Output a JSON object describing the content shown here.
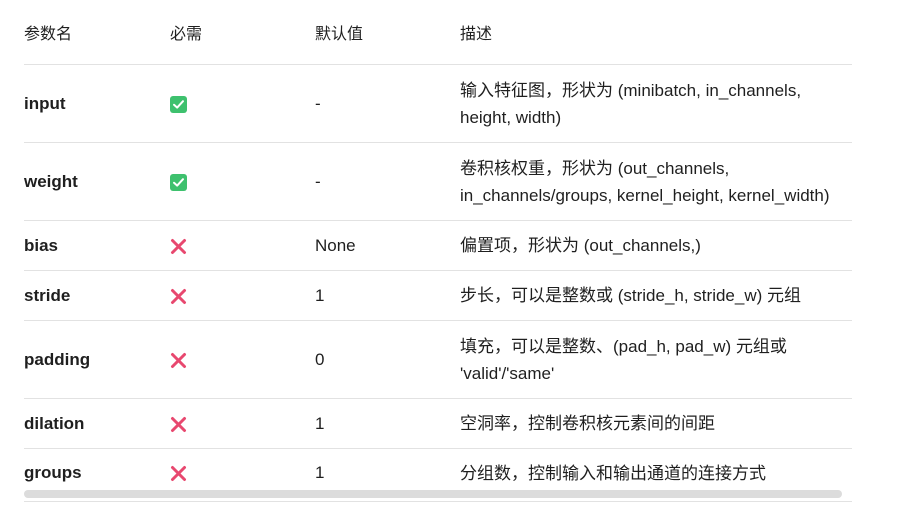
{
  "headers": {
    "name": "参数名",
    "required": "必需",
    "default": "默认值",
    "desc": "描述"
  },
  "rows": [
    {
      "name": "input",
      "required": true,
      "required_icon": "check-icon",
      "default": "-",
      "desc": "输入特征图，形状为 (minibatch, in_channels, height, width)"
    },
    {
      "name": "weight",
      "required": true,
      "required_icon": "check-icon",
      "default": "-",
      "desc": "卷积核权重，形状为 (out_channels, in_channels/groups, kernel_height, kernel_width)"
    },
    {
      "name": "bias",
      "required": false,
      "required_icon": "cross-icon",
      "default": "None",
      "desc": "偏置项，形状为 (out_channels,)"
    },
    {
      "name": "stride",
      "required": false,
      "required_icon": "cross-icon",
      "default": "1",
      "desc": "步长，可以是整数或 (stride_h, stride_w) 元组"
    },
    {
      "name": "padding",
      "required": false,
      "required_icon": "cross-icon",
      "default": "0",
      "desc": "填充，可以是整数、(pad_h, pad_w) 元组或 'valid'/'same'"
    },
    {
      "name": "dilation",
      "required": false,
      "required_icon": "cross-icon",
      "default": "1",
      "desc": "空洞率，控制卷积核元素间的间距"
    },
    {
      "name": "groups",
      "required": false,
      "required_icon": "cross-icon",
      "default": "1",
      "desc": "分组数，控制输入和输出通道的连接方式"
    }
  ],
  "colors": {
    "check": "#3ec16e",
    "cross": "#e8486f",
    "border": "#e2e2e2"
  }
}
